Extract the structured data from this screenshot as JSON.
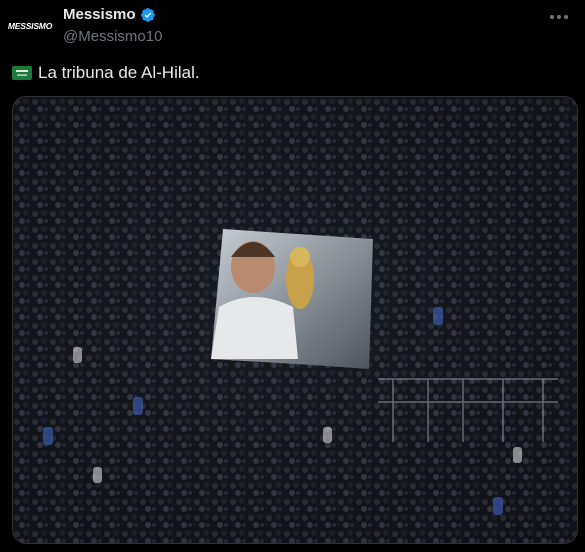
{
  "author": {
    "avatar_text": "MESSISMO",
    "display_name": "Messismo",
    "handle": "@Messismo10",
    "verified": true
  },
  "tweet": {
    "flag": "saudi-arabia-flag-emoji",
    "text": "La tribuna de Al-Hilal."
  },
  "media": {
    "subject": "stadium-crowd-with-messi-banner-photo"
  },
  "colors": {
    "background": "#000000",
    "text": "#e7e9ea",
    "secondary": "#71767b",
    "verified": "#1d9bf0",
    "border": "#2f3336"
  }
}
